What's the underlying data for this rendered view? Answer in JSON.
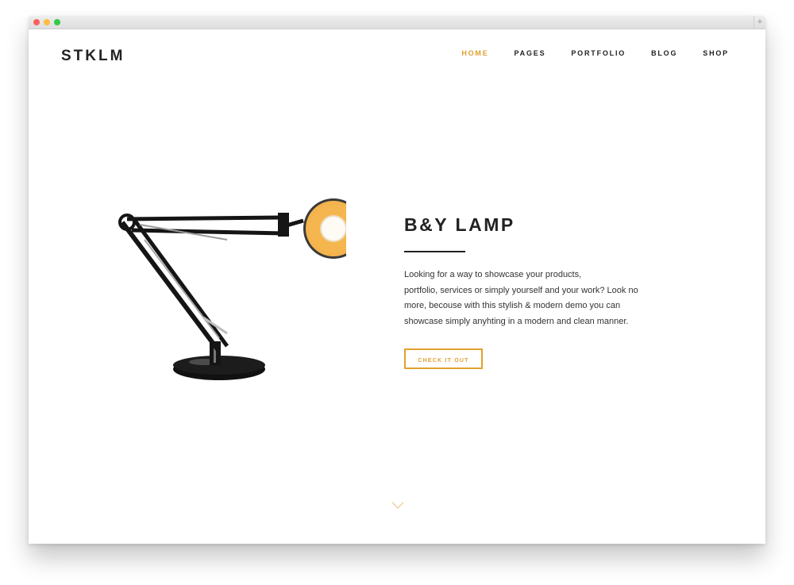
{
  "brand": {
    "logo": "STKLM"
  },
  "nav": {
    "items": [
      {
        "label": "HOME",
        "active": true
      },
      {
        "label": "PAGES",
        "active": false
      },
      {
        "label": "PORTFOLIO",
        "active": false
      },
      {
        "label": "BLOG",
        "active": false
      },
      {
        "label": "SHOP",
        "active": false
      }
    ]
  },
  "hero": {
    "title": "B&Y LAMP",
    "description_lines": [
      "Looking for a way to showcase your products,",
      "portfolio, services or simply yourself and your work? Look no",
      "more, becouse with this stylish & modern demo you can",
      "showcase simply anyhting in a modern and clean manner."
    ],
    "cta_label": "CHECK IT OUT"
  },
  "icons": {
    "scroll_down": "chevron-down-icon",
    "new_tab": "plus-icon"
  },
  "colors": {
    "accent": "#e2a12d",
    "text": "#222222",
    "lamp_shade": "#f3b34d"
  }
}
